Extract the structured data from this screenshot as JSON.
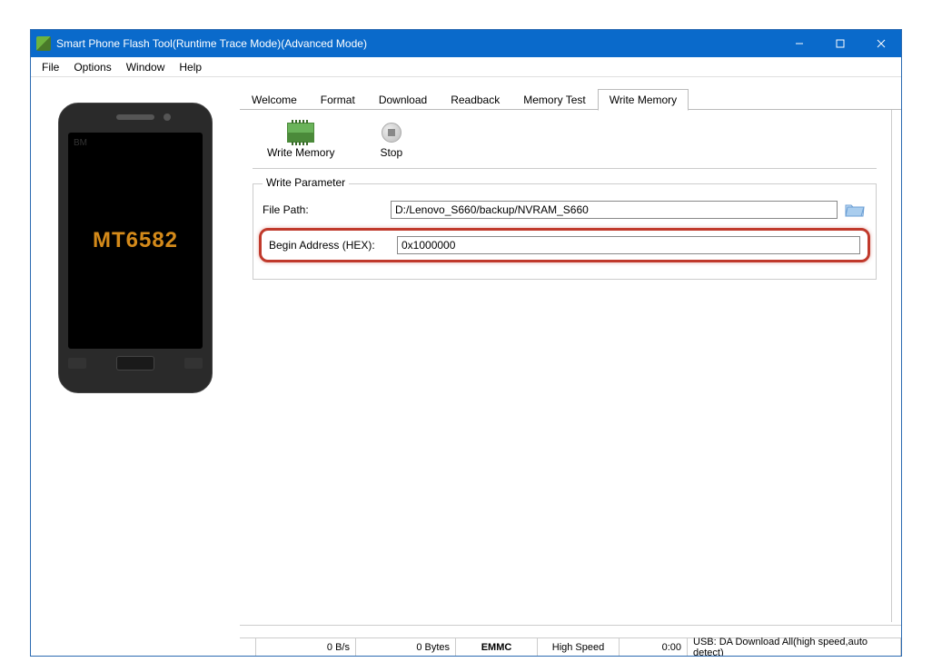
{
  "window": {
    "title": "Smart Phone Flash Tool(Runtime Trace Mode)(Advanced Mode)"
  },
  "menubar": {
    "items": [
      "File",
      "Options",
      "Window",
      "Help"
    ]
  },
  "phone": {
    "bm_label": "BM",
    "chipset": "MT6582"
  },
  "tabs": {
    "items": [
      "Welcome",
      "Format",
      "Download",
      "Readback",
      "Memory Test",
      "Write Memory"
    ],
    "active_index": 5
  },
  "toolbar": {
    "write_memory_label": "Write Memory",
    "stop_label": "Stop"
  },
  "write_parameter": {
    "group_title": "Write Parameter",
    "file_path_label": "File Path:",
    "file_path_value": "D:/Lenovo_S660/backup/NVRAM_S660",
    "begin_addr_label": "Begin Address (HEX):",
    "begin_addr_value": "0x1000000"
  },
  "statusbar": {
    "speed": "0 B/s",
    "bytes": "0 Bytes",
    "storage": "EMMC",
    "mode": "High Speed",
    "time": "0:00",
    "usb": "USB: DA Download All(high speed,auto detect)"
  }
}
